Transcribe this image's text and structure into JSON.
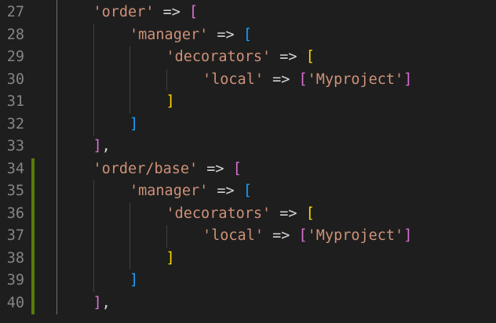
{
  "editor": {
    "lines": [
      {
        "num": "27",
        "indent": 1,
        "tokens": [
          [
            "str",
            "'order'"
          ],
          [
            "op",
            " => "
          ],
          [
            "b1",
            "["
          ]
        ]
      },
      {
        "num": "28",
        "indent": 2,
        "tokens": [
          [
            "str",
            "'manager'"
          ],
          [
            "op",
            " => "
          ],
          [
            "b2",
            "["
          ]
        ]
      },
      {
        "num": "29",
        "indent": 3,
        "tokens": [
          [
            "str",
            "'decorators'"
          ],
          [
            "op",
            " => "
          ],
          [
            "b3",
            "["
          ]
        ]
      },
      {
        "num": "30",
        "indent": 4,
        "tokens": [
          [
            "str",
            "'local'"
          ],
          [
            "op",
            " => "
          ],
          [
            "b1",
            "["
          ],
          [
            "str",
            "'Myproject'"
          ],
          [
            "b1",
            "]"
          ]
        ]
      },
      {
        "num": "31",
        "indent": 3,
        "tokens": [
          [
            "b3",
            "]"
          ]
        ]
      },
      {
        "num": "32",
        "indent": 2,
        "tokens": [
          [
            "b2",
            "]"
          ]
        ]
      },
      {
        "num": "33",
        "indent": 1,
        "tokens": [
          [
            "b1",
            "]"
          ],
          [
            "pun",
            ","
          ]
        ]
      },
      {
        "num": "34",
        "indent": 1,
        "modified": true,
        "tokens": [
          [
            "str",
            "'order/base'"
          ],
          [
            "op",
            " => "
          ],
          [
            "b1",
            "["
          ]
        ]
      },
      {
        "num": "35",
        "indent": 2,
        "modified": true,
        "tokens": [
          [
            "str",
            "'manager'"
          ],
          [
            "op",
            " => "
          ],
          [
            "b2",
            "["
          ]
        ]
      },
      {
        "num": "36",
        "indent": 3,
        "modified": true,
        "tokens": [
          [
            "str",
            "'decorators'"
          ],
          [
            "op",
            " => "
          ],
          [
            "b3",
            "["
          ]
        ]
      },
      {
        "num": "37",
        "indent": 4,
        "modified": true,
        "tokens": [
          [
            "str",
            "'local'"
          ],
          [
            "op",
            " => "
          ],
          [
            "b1",
            "["
          ],
          [
            "str",
            "'Myproject'"
          ],
          [
            "b1",
            "]"
          ]
        ]
      },
      {
        "num": "38",
        "indent": 3,
        "modified": true,
        "tokens": [
          [
            "b3",
            "]"
          ]
        ]
      },
      {
        "num": "39",
        "indent": 2,
        "modified": true,
        "tokens": [
          [
            "b2",
            "]"
          ]
        ]
      },
      {
        "num": "40",
        "indent": 1,
        "modified": true,
        "tokens": [
          [
            "b1",
            "]"
          ],
          [
            "pun",
            ","
          ]
        ]
      }
    ]
  },
  "colors": {
    "background": "#1e1e1e",
    "line_number": "#858585",
    "string": "#ce9178",
    "bracket_level_1": "#da70d6",
    "bracket_level_2": "#179fff",
    "bracket_level_3": "#ffd700",
    "modified_gutter": "#587c0c"
  }
}
